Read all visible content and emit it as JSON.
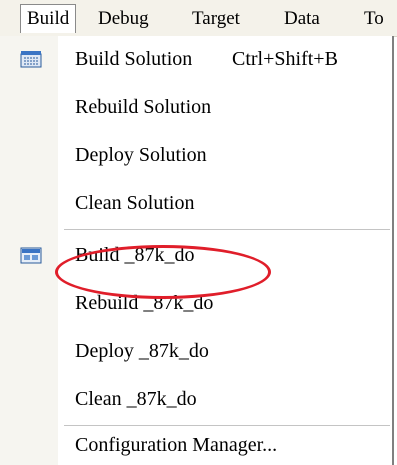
{
  "menubar": {
    "items": [
      {
        "label": "Build"
      },
      {
        "label": "Debug"
      },
      {
        "label": "Target"
      },
      {
        "label": "Data"
      },
      {
        "label": "To"
      }
    ]
  },
  "dropdown": {
    "items": [
      {
        "label": "Build Solution",
        "shortcut": "Ctrl+Shift+B",
        "icon": "build-solution-icon"
      },
      {
        "label": "Rebuild Solution"
      },
      {
        "label": "Deploy Solution"
      },
      {
        "label": "Clean Solution"
      },
      {
        "label": "Build _87k_do",
        "icon": "build-project-icon",
        "highlighted": true
      },
      {
        "label": "Rebuild _87k_do"
      },
      {
        "label": "Deploy _87k_do"
      },
      {
        "label": "Clean _87k_do"
      },
      {
        "label": "Configuration Manager..."
      }
    ]
  },
  "annotation": {
    "color": "#e01e2a"
  }
}
